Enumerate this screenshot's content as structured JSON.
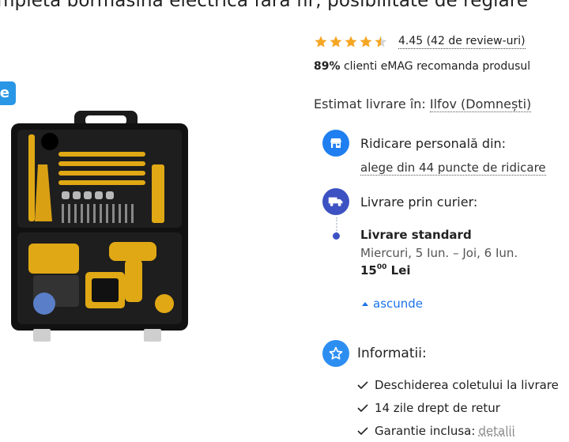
{
  "product": {
    "title": "mpleta bormasina electrica fara fir, posibilitate de reglare",
    "badge_text": "e"
  },
  "rating": {
    "value_text": "4.45 (42 de review-uri)",
    "stars_filled": 4.45,
    "stars_total": 5,
    "star_color": "#f5a623"
  },
  "recommend": {
    "percent": "89%",
    "text": "clienti eMAG recomanda produsul"
  },
  "estimate": {
    "label": "Estimat livrare în:",
    "location": "Ilfov (Domnești)"
  },
  "pickup": {
    "icon": "store-icon",
    "title": "Ridicare personală din:",
    "link": "alege din 44 puncte de ridicare"
  },
  "courier": {
    "icon": "truck-icon",
    "title": "Livrare prin curier:",
    "standard_title": "Livrare standard",
    "date": "Miercuri, 5 Iun. – Joi, 6 Iun.",
    "price_main": "15",
    "price_sup": "00",
    "currency": "Lei",
    "hide_label": "ascunde"
  },
  "info": {
    "icon": "star-outline-icon",
    "title": "Informatii:",
    "items": [
      "Deschiderea coletului la livrare",
      "14 zile drept de retur",
      "Garantie inclusa:"
    ],
    "extra_link": "detalii"
  },
  "colors": {
    "accent_blue": "#1f7ff0",
    "navy": "#3d52c2",
    "link": "#1a73e8"
  }
}
